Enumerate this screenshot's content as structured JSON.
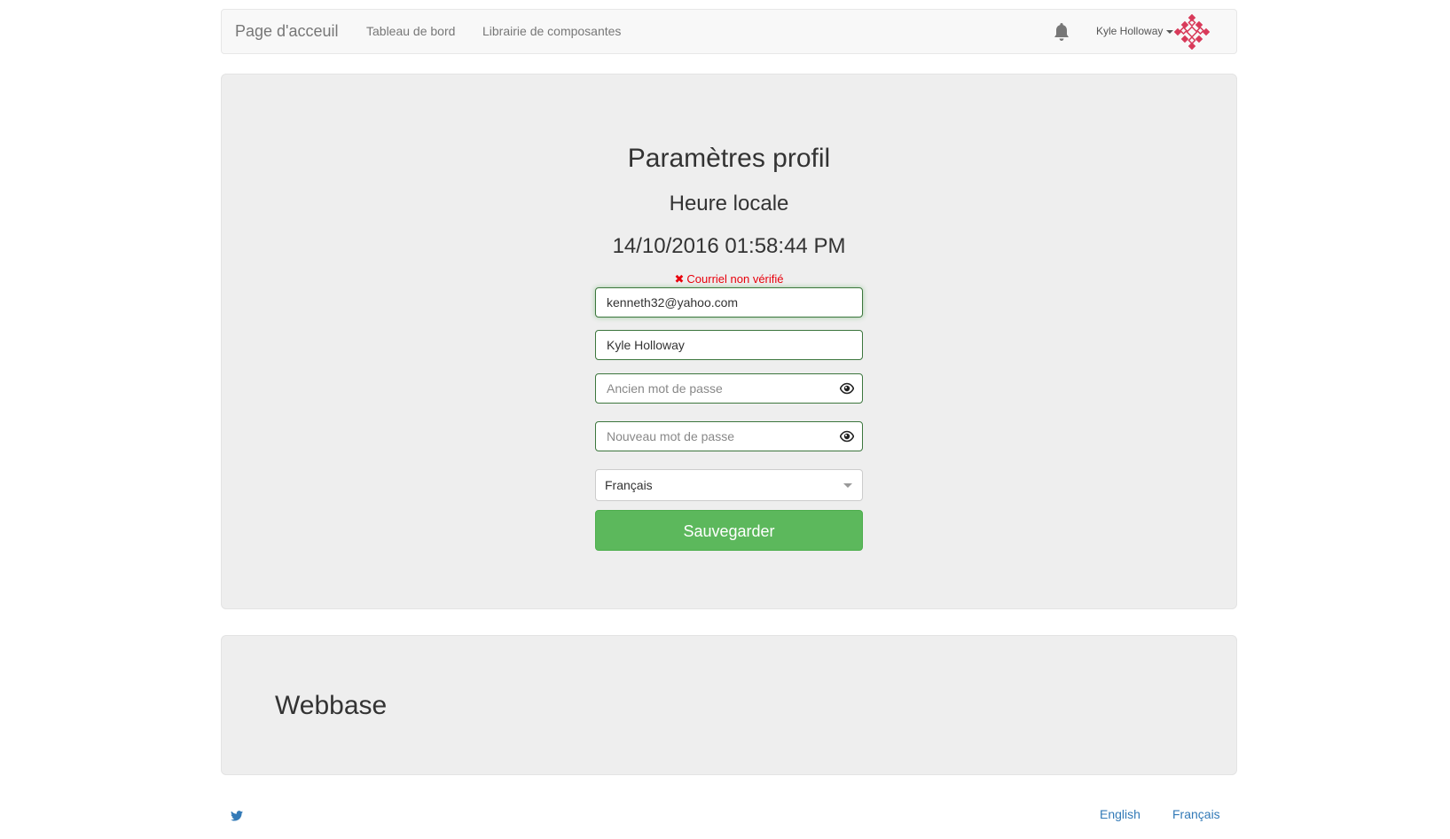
{
  "navbar": {
    "brand": "Page d'acceuil",
    "links": [
      "Tableau de bord",
      "Librairie de composantes"
    ],
    "notification_icon": "bell-icon",
    "user_name": "Kyle Holloway"
  },
  "profile": {
    "title": "Paramètres profil",
    "subtitle": "Heure locale",
    "clock": "14/10/2016 01:58:44 PM",
    "verification_icon": "x-icon",
    "verification_text": "Courriel non vérifié",
    "email_value": "kenneth32@yahoo.com",
    "name_value": "Kyle Holloway",
    "old_password_placeholder": "Ancien mot de passe",
    "new_password_placeholder": "Nouveau mot de passe",
    "language_selected": "Français",
    "save_label": "Sauvegarder"
  },
  "footer": {
    "title": "Webbase",
    "social_icon": "twitter-icon",
    "languages": [
      "English",
      "Français"
    ]
  },
  "colors": {
    "save_button": "#5cb85c",
    "error_text": "#e8000c",
    "link": "#337ab7",
    "field_border": "#3c763d"
  }
}
